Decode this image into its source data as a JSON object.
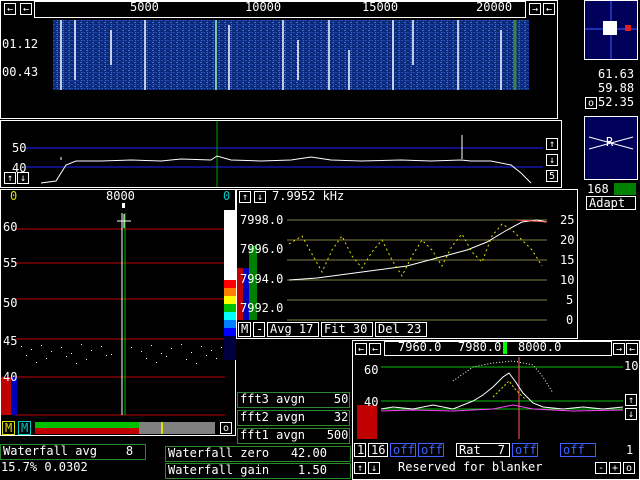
{
  "colors": {
    "accent_green": "#00c000",
    "red": "#c00000",
    "blue": "#0000c0",
    "cyan": "#00c8c8",
    "yellow": "#e0e000",
    "magenta": "#ff40ff"
  },
  "top_ruler": {
    "ticks": [
      "5000",
      "10000",
      "15000",
      "20000"
    ]
  },
  "waterfall": {
    "level1": "01.12",
    "level2": "00.43"
  },
  "right_readouts": {
    "v1": "61.63",
    "v2": "59.88",
    "v3": "52.35",
    "btn_o": "o"
  },
  "spectrum": {
    "level50": "50",
    "level40": "40",
    "right_num": "5"
  },
  "mini_panel": {
    "label": "R",
    "num": "168",
    "adapt": "Adapt"
  },
  "baseband": {
    "left_zero": "0",
    "center_freq": "8000",
    "right_zero": "0",
    "y_labels": [
      "60",
      "55",
      "50",
      "45",
      "40"
    ],
    "m1": "M",
    "m2": "M",
    "o": "o"
  },
  "afc": {
    "freq": "7.9952 kHz",
    "y_labels": [
      "7998.0",
      "7996.0",
      "7994.0",
      "7992.0"
    ],
    "r_labels": [
      "25",
      "20",
      "15",
      "10",
      "5",
      "0"
    ],
    "m": "M",
    "minus": "-",
    "avg": "Avg 17",
    "fit": "Fit 30",
    "del": "Del 23"
  },
  "fft": {
    "fft3": "fft3 avgn    50",
    "fft2": "fft2 avgn    32",
    "fft1": "fft1 avgn   500"
  },
  "bottom_left": {
    "wf_avg": "Waterfall avg    8",
    "status": "15.7% 0.0302"
  },
  "wf_params": {
    "zero": "Waterfall zero   42.00",
    "gain": "Waterfall gain    1.50"
  },
  "hires": {
    "ticks": [
      "7960.0",
      "7980.0",
      "8000.0"
    ],
    "y60": "60",
    "y40": "40",
    "y10": "10",
    "num1": "1",
    "num16": "16",
    "off1": "off",
    "off2": "off",
    "rat": "Rat",
    "rat_val": "7",
    "off3": "off",
    "off4": "off",
    "right_one": "1",
    "reserved": "Reserved for blanker",
    "plus": "+",
    "o": "o"
  },
  "icons": {
    "left": "arrow-left-icon",
    "right": "arrow-right-icon",
    "up": "arrow-up-icon",
    "down": "arrow-down-icon"
  }
}
